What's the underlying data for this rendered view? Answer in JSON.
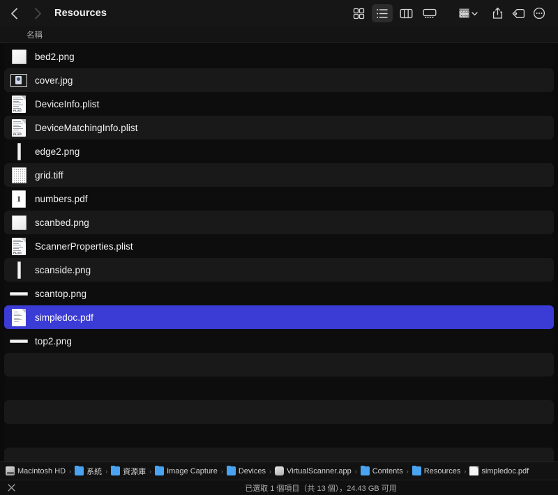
{
  "window": {
    "title": "Resources"
  },
  "toolbar": {
    "back_icon": "chevron-left-icon",
    "forward_icon": "chevron-right-icon",
    "view_icon_label": "icon-view-button",
    "view_list_label": "list-view-button",
    "view_column_label": "column-view-button",
    "view_gallery_label": "gallery-view-button",
    "group_label": "group-by-button",
    "share_label": "share-button",
    "tag_label": "tag-button",
    "more_label": "more-options-button"
  },
  "columns": {
    "name": "名稱"
  },
  "files": [
    {
      "name": "bed2.png",
      "icon": "image-square-icon",
      "selected": false
    },
    {
      "name": "cover.jpg",
      "icon": "photo-thumb-icon",
      "selected": false
    },
    {
      "name": "DeviceInfo.plist",
      "icon": "plist-doc-icon",
      "selected": false
    },
    {
      "name": "DeviceMatchingInfo.plist",
      "icon": "plist-doc-icon",
      "selected": false
    },
    {
      "name": "edge2.png",
      "icon": "vertical-bar-icon",
      "selected": false
    },
    {
      "name": "grid.tiff",
      "icon": "grid-pattern-icon",
      "selected": false
    },
    {
      "name": "numbers.pdf",
      "icon": "page-number-icon",
      "selected": false
    },
    {
      "name": "scanbed.png",
      "icon": "image-square-icon",
      "selected": false
    },
    {
      "name": "ScannerProperties.plist",
      "icon": "plist-doc-icon",
      "selected": false
    },
    {
      "name": "scanside.png",
      "icon": "vertical-bar-icon",
      "selected": false
    },
    {
      "name": "scantop.png",
      "icon": "horizontal-bar-icon",
      "selected": false
    },
    {
      "name": "simpledoc.pdf",
      "icon": "pdf-doc-icon",
      "selected": true
    },
    {
      "name": "top2.png",
      "icon": "horizontal-bar-icon",
      "selected": false
    }
  ],
  "breadcrumb": [
    {
      "label": "Macintosh HD",
      "icon": "disk-icon"
    },
    {
      "label": "系統",
      "icon": "folder-icon"
    },
    {
      "label": "資源庫",
      "icon": "folder-icon"
    },
    {
      "label": "Image Capture",
      "icon": "folder-icon"
    },
    {
      "label": "Devices",
      "icon": "folder-icon"
    },
    {
      "label": "VirtualScanner.app",
      "icon": "app-icon"
    },
    {
      "label": "Contents",
      "icon": "folder-icon"
    },
    {
      "label": "Resources",
      "icon": "folder-icon"
    },
    {
      "label": "simpledoc.pdf",
      "icon": "file-icon"
    }
  ],
  "breadcrumb_separator": "›",
  "status": {
    "text": "已選取 1 個項目（共 13 個），24.43 GB 可用",
    "close_icon": "close-x-icon"
  },
  "colors": {
    "selection_blue": "#3b3bd6",
    "row_dark": "#0d0d0d",
    "row_light": "#191919",
    "toolbar_bg": "#161616",
    "folder_blue": "#4aa3f0"
  }
}
